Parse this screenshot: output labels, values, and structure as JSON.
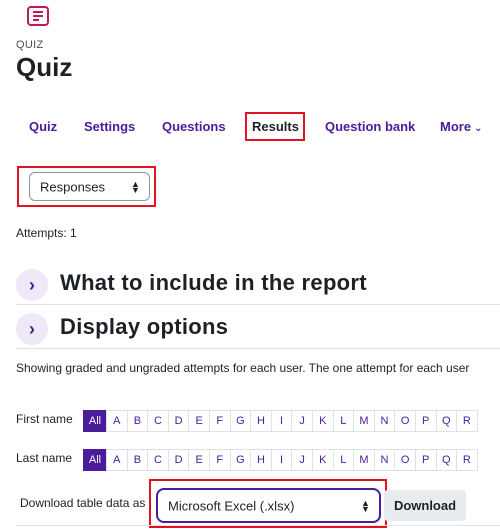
{
  "header": {
    "kicker": "QUIZ",
    "title": "Quiz"
  },
  "nav": {
    "items": [
      {
        "label": "Quiz"
      },
      {
        "label": "Settings"
      },
      {
        "label": "Questions"
      },
      {
        "label": "Results"
      },
      {
        "label": "Question bank"
      },
      {
        "label": "More"
      }
    ],
    "active": "Results"
  },
  "report_select": {
    "value": "Responses"
  },
  "attempts": "Attempts: 1",
  "sections": {
    "include": "What to include in the report",
    "display": "Display options"
  },
  "info_text": "Showing graded and ungraded attempts for each user. The one attempt for each user",
  "initials": {
    "first_label": "First name",
    "last_label": "Last name",
    "all_label": "All",
    "letters": [
      "A",
      "B",
      "C",
      "D",
      "E",
      "F",
      "G",
      "H",
      "I",
      "J",
      "K",
      "L",
      "M",
      "N",
      "O",
      "P",
      "Q",
      "R"
    ]
  },
  "download": {
    "label": "Download table data as",
    "format": "Microsoft Excel (.xlsx)",
    "button": "Download"
  },
  "colors": {
    "brand": "#4a1c99",
    "highlight": "#e0141e"
  },
  "icons": {
    "quiz": "quiz-icon",
    "chevron": "chevron-right-icon",
    "more": "chevron-down-icon",
    "select": "sort-arrows-icon"
  }
}
